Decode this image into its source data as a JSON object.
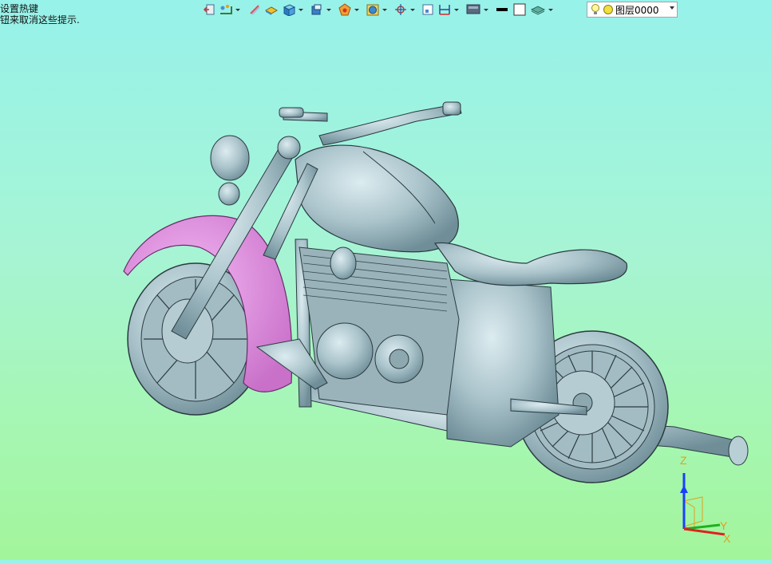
{
  "hint": {
    "line1": "设置热键",
    "line2": "钮来取消这些提示."
  },
  "toolbar": {
    "icons": [
      "exit-icon",
      "snap-icon",
      "wireframe-icon",
      "surface-icon",
      "solid-box-icon",
      "view-cube-icon",
      "render-icon",
      "section-icon",
      "axis-icon",
      "frame-icon",
      "dimension-icon",
      "display-icon",
      "line-color-icon",
      "fill-color-icon",
      "layer-stack-icon"
    ],
    "layer_selector": {
      "value": "图层0000"
    }
  },
  "colors": {
    "background_top": "#97f2ea",
    "background_bottom": "#a3f59b",
    "model_body": "#9fb9c2",
    "fender_highlight": "#e08ce0",
    "axis_z": "#1a3fff",
    "axis_x": "#e02020",
    "axis_y": "#20b020"
  },
  "triad": {
    "z": "Z",
    "y": "Y",
    "x": "X"
  }
}
